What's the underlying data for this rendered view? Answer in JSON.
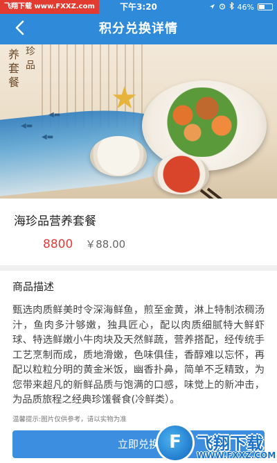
{
  "status_bar": {
    "watermark": "飞翔下载 www.FXXZ.com",
    "time": "下午3:20",
    "battery_percent": "46%",
    "battery_level": 0.46,
    "icons": [
      "location-icon",
      "alarm-icon",
      "bluetooth-icon",
      "battery-icon"
    ]
  },
  "nav": {
    "title": "积分兑换详情",
    "back_icon": "chevron-left-icon"
  },
  "hero": {
    "calligraphy_left": "养套餐",
    "calligraphy_right": "珍品"
  },
  "product": {
    "name": "海珍品营养套餐",
    "points": "8800",
    "price": "￥88.00"
  },
  "description": {
    "label": "商品描述",
    "text": "甄选肉质鲜美时令深海鲜鱼，煎至金黄，淋上特制浓稠汤汁，鱼肉多汁够嫩，独具匠心，配以肉质细腻特大鲜虾球、特选鲜嫩小牛肉块及天然鲜蔬，营养搭配，经传统手工艺烹制而成，质地滑嫩，色味俱佳，香醇难以忘怀，再配以粒粒分明的黄金米饭，幽香扑鼻，简单不乏精致，为您带来超凡的新鲜品质与饱满的口感，味觉上的新冲击，为品质旅程之经典珍馐餐食(冷鲜类）。",
    "tip": "温馨提示:图片仅供参考，请以实物为准"
  },
  "action": {
    "redeem_label": "立即兑换"
  },
  "watermark_logo": {
    "brand": "飞翔下载",
    "url": "WWW.FXXZ.COM"
  },
  "colors": {
    "primary": "#2f8bd9",
    "button": "#3b8ee0",
    "points": "#e03c3c",
    "watermark_red": "#e23b2f"
  }
}
